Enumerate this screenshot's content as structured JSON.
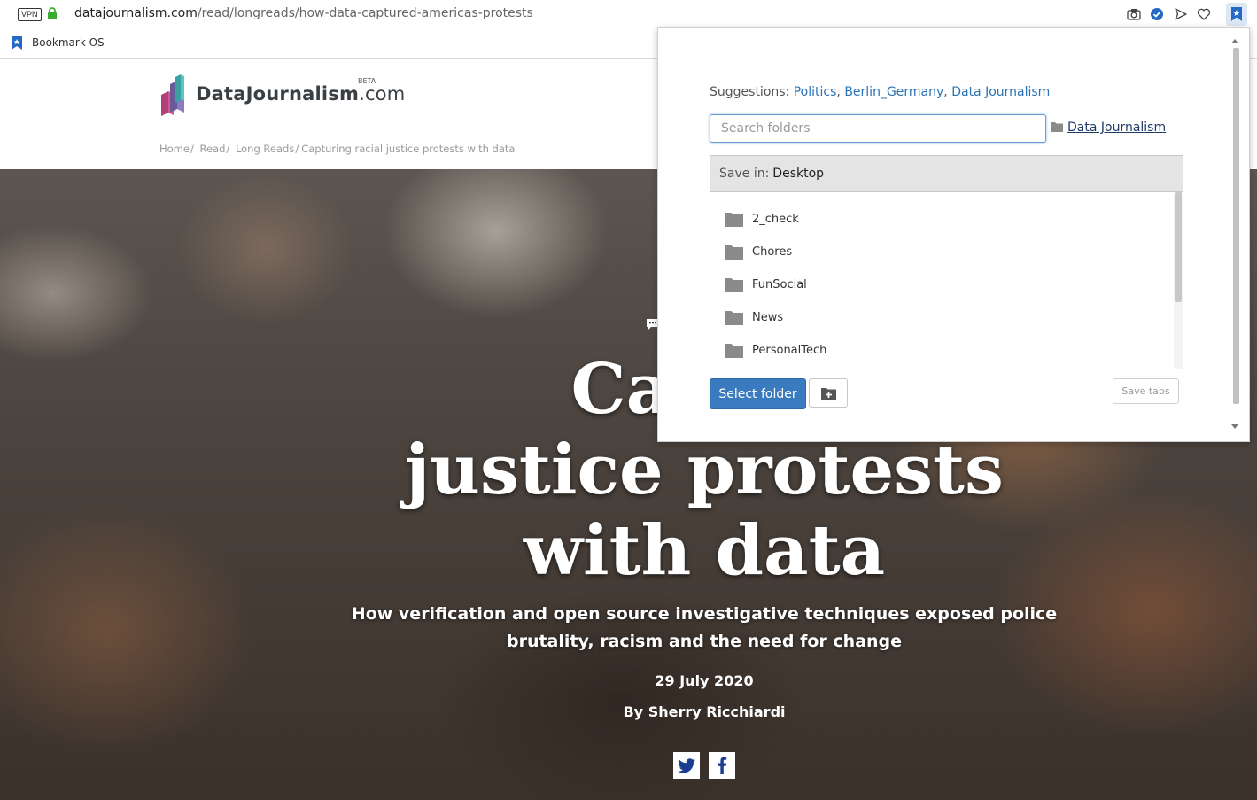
{
  "browser": {
    "vpn_label": "VPN",
    "url_host": "datajournalism.com",
    "url_path": "/read/longreads/how-data-captured-americas-protests",
    "bookmarks_bar": [
      {
        "label": "Bookmark OS"
      }
    ]
  },
  "site": {
    "logo_name": "DataJournalism",
    "logo_tld": ".com",
    "logo_badge": "BETA",
    "breadcrumb": [
      "Home",
      "Read",
      "Long Reads",
      "Capturing racial justice protests with data"
    ],
    "breadcrumb_sep": "/"
  },
  "article": {
    "title_line1": "Captur",
    "title_line2": "justice protests",
    "title_line3": "with data",
    "subtitle": "How verification and open source investigative techniques exposed police brutality, racism and the need for change",
    "date": "29 July 2020",
    "byline_prefix": "By",
    "author": "Sherry Ricchiardi"
  },
  "popup": {
    "suggestions_label": "Suggestions:",
    "suggestions": [
      "Politics",
      "Berlin_Germany",
      "Data Journalism"
    ],
    "search_placeholder": "Search folders",
    "search_value": "",
    "last_folder": "Data Journalism",
    "save_in_label": "Save in:",
    "save_in_value": "Desktop",
    "folders": [
      "2_check",
      "Chores",
      "FunSocial",
      "News",
      "PersonalTech"
    ],
    "select_button": "Select folder",
    "save_tabs_button": "Save tabs"
  },
  "colors": {
    "accent": "#3a7bbf",
    "link": "#2a72b5",
    "secure_lock": "#3bab2f",
    "extension_blue": "#2469c6"
  }
}
